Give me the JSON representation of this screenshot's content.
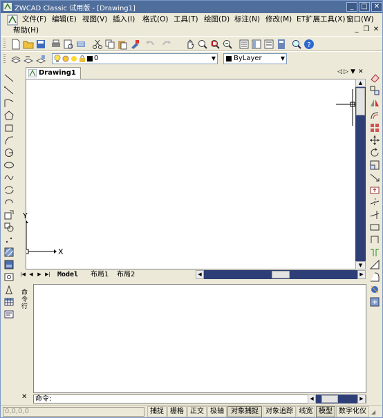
{
  "window": {
    "title": "ZWCAD Classic 试用版 - [Drawing1]",
    "minimize": "_",
    "maximize": "□",
    "close": "✕"
  },
  "menu": {
    "items": [
      "文件(F)",
      "编辑(E)",
      "视图(V)",
      "插入(I)",
      "格式(O)",
      "工具(T)",
      "绘图(D)",
      "标注(N)",
      "修改(M)",
      "ET扩展工具(X)",
      "窗口(W)"
    ],
    "help": "帮助(H)",
    "mdi_min": "_",
    "mdi_restore": "❐",
    "mdi_close": "✕"
  },
  "layer_bar": {
    "layer_name": "0",
    "linetype": "ByLayer"
  },
  "document_tab": {
    "label": "Drawing1"
  },
  "canvas": {
    "y_axis": "Y",
    "x_axis": "X"
  },
  "layout_tabs": [
    "Model",
    "布局1",
    "布局2"
  ],
  "command": {
    "side_label": "命令行",
    "prompt": "命令:"
  },
  "status": {
    "coordinates": "0,0,0,0",
    "buttons": [
      "捕捉",
      "栅格",
      "正交",
      "极轴",
      "对象捕捉",
      "对象追踪",
      "线宽",
      "模型",
      "数字化仪"
    ]
  },
  "colors": {
    "accent": "#2d3f76",
    "titlebar": "#4f6e9c",
    "canvas": "#ffffff",
    "chrome": "#ece9d8"
  }
}
